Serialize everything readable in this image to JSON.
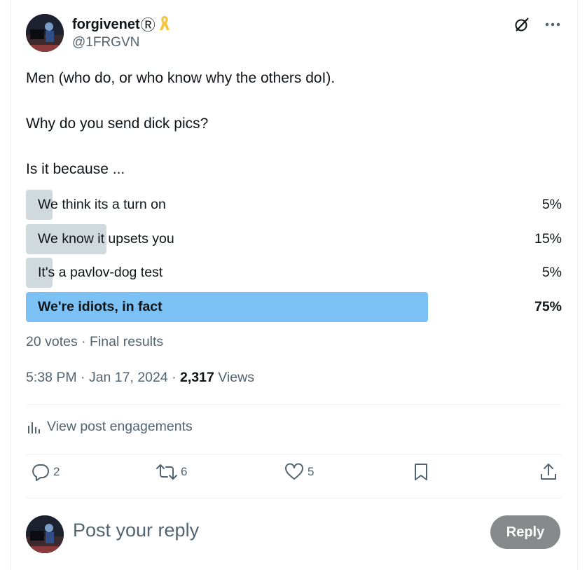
{
  "author": {
    "display_name": "forgivenet",
    "registered_mark": "Ⓡ",
    "handle": "@1FRGVN"
  },
  "post": {
    "text": "Men (who do, or who know why the others doI).\n\nWhy do you send dick pics?\n\nIs it because ..."
  },
  "poll": {
    "options": [
      {
        "label": "We think its a turn on",
        "percent_label": "5%",
        "percent": 5,
        "winner": false
      },
      {
        "label": "We know it upsets you",
        "percent_label": "15%",
        "percent": 15,
        "winner": false
      },
      {
        "label": "It's a pavlov-dog test",
        "percent_label": "5%",
        "percent": 5,
        "winner": false
      },
      {
        "label": "We're idiots, in fact",
        "percent_label": "75%",
        "percent": 75,
        "winner": true
      }
    ],
    "meta": "20 votes · Final results"
  },
  "timestamp": {
    "time_date": "5:38 PM · Jan 17, 2024 · ",
    "views_count": "2,317",
    "views_label": " Views"
  },
  "engagements_label": "View post engagements",
  "actions": {
    "replies": "2",
    "reposts": "6",
    "likes": "5"
  },
  "reply": {
    "placeholder": "Post your reply",
    "button_label": "Reply"
  },
  "colors": {
    "poll_bar": "#cfd9de",
    "poll_winner_bar": "#7cc1f4",
    "secondary_text": "#536471",
    "reply_button": "#87898c"
  },
  "icons": [
    "grok-icon",
    "more-icon",
    "analytics-icon",
    "reply-icon",
    "repost-icon",
    "like-icon",
    "bookmark-icon",
    "share-icon",
    "awareness-ribbon-icon"
  ]
}
